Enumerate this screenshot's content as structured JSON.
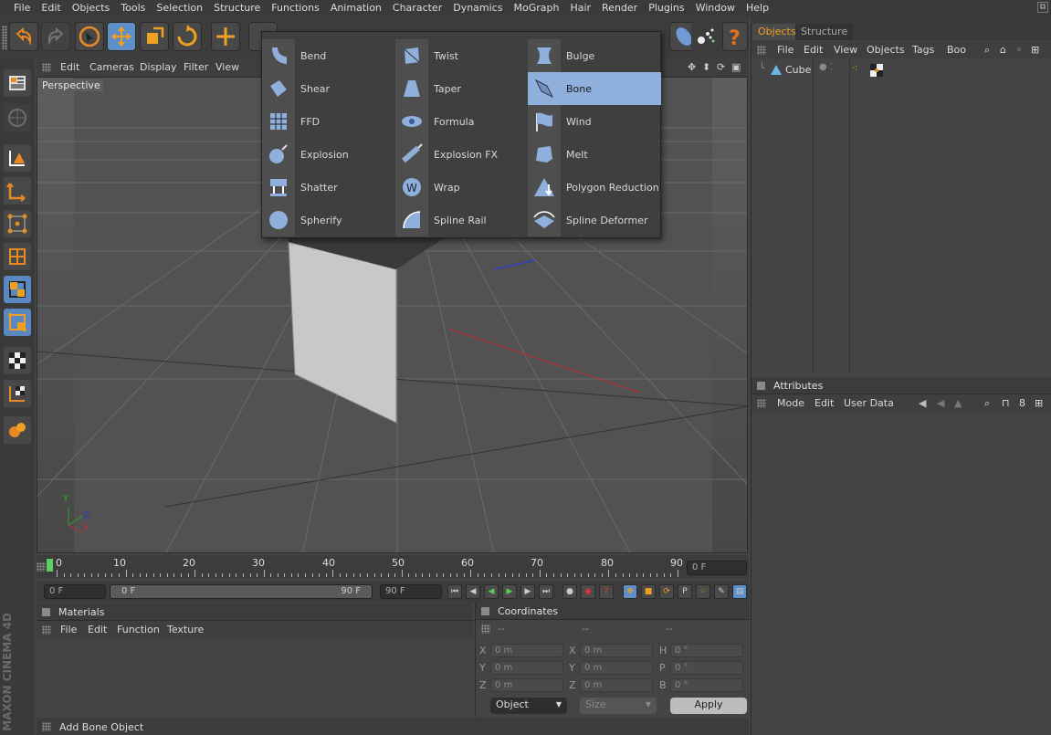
{
  "menubar": [
    "File",
    "Edit",
    "Objects",
    "Tools",
    "Selection",
    "Structure",
    "Functions",
    "Animation",
    "Character",
    "Dynamics",
    "MoGraph",
    "Hair",
    "Render",
    "Plugins",
    "Window",
    "Help"
  ],
  "viewport": {
    "menu": [
      "Edit",
      "Cameras",
      "Display",
      "Filter",
      "View"
    ],
    "label": "Perspective",
    "axes": {
      "y": "Y",
      "z": "Z",
      "x": "X"
    }
  },
  "deformers_popup": {
    "columns": [
      [
        {
          "label": "Bend",
          "icon": "bend-icon"
        },
        {
          "label": "Shear",
          "icon": "shear-icon"
        },
        {
          "label": "FFD",
          "icon": "ffd-icon"
        },
        {
          "label": "Explosion",
          "icon": "explosion-icon"
        },
        {
          "label": "Shatter",
          "icon": "shatter-icon"
        },
        {
          "label": "Spherify",
          "icon": "spherify-icon"
        }
      ],
      [
        {
          "label": "Twist",
          "icon": "twist-icon"
        },
        {
          "label": "Taper",
          "icon": "taper-icon"
        },
        {
          "label": "Formula",
          "icon": "formula-icon"
        },
        {
          "label": "Explosion FX",
          "icon": "explosion-fx-icon"
        },
        {
          "label": "Wrap",
          "icon": "wrap-icon"
        },
        {
          "label": "Spline Rail",
          "icon": "spline-rail-icon"
        }
      ],
      [
        {
          "label": "Bulge",
          "icon": "bulge-icon"
        },
        {
          "label": "Bone",
          "icon": "bone-icon",
          "selected": true
        },
        {
          "label": "Wind",
          "icon": "wind-icon"
        },
        {
          "label": "Melt",
          "icon": "melt-icon"
        },
        {
          "label": "Polygon Reduction",
          "icon": "polygon-reduction-icon"
        },
        {
          "label": "Spline Deformer",
          "icon": "spline-deformer-icon"
        }
      ]
    ]
  },
  "timeline": {
    "ticks": [
      "0",
      "10",
      "20",
      "30",
      "40",
      "50",
      "60",
      "70",
      "80",
      "90"
    ],
    "current_frame": "0 F",
    "start_field": "0 F",
    "range_start": "0 F",
    "range_end": "90 F",
    "end_field": "90 F"
  },
  "materials": {
    "title": "Materials",
    "menu": [
      "File",
      "Edit",
      "Function",
      "Texture"
    ]
  },
  "coordinates": {
    "title": "Coordinates",
    "col_headers": [
      "--",
      "--",
      "--"
    ],
    "rows": [
      {
        "a": "X",
        "av": "0 m",
        "b": "X",
        "bv": "0 m",
        "c": "H",
        "cv": "0 °"
      },
      {
        "a": "Y",
        "av": "0 m",
        "b": "Y",
        "bv": "0 m",
        "c": "P",
        "cv": "0 °"
      },
      {
        "a": "Z",
        "av": "0 m",
        "b": "Z",
        "bv": "0 m",
        "c": "B",
        "cv": "0 °"
      }
    ],
    "mode_select": "Object",
    "size_select": "Size",
    "apply": "Apply"
  },
  "objects_panel": {
    "tabs": [
      "Objects",
      "Structure"
    ],
    "menu": [
      "File",
      "Edit",
      "View",
      "Objects",
      "Tags",
      "Boo"
    ],
    "items": [
      {
        "name": "Cube"
      }
    ]
  },
  "attributes_panel": {
    "title": "Attributes",
    "menu": [
      "Mode",
      "Edit",
      "User Data"
    ]
  },
  "status": "Add Bone Object",
  "brand": "MAXON CINEMA 4D",
  "colors": {
    "accent": "#5f8fc8",
    "selection": "#8fb0dc",
    "tab_active": "#f0a020",
    "playhead": "#59d164"
  }
}
